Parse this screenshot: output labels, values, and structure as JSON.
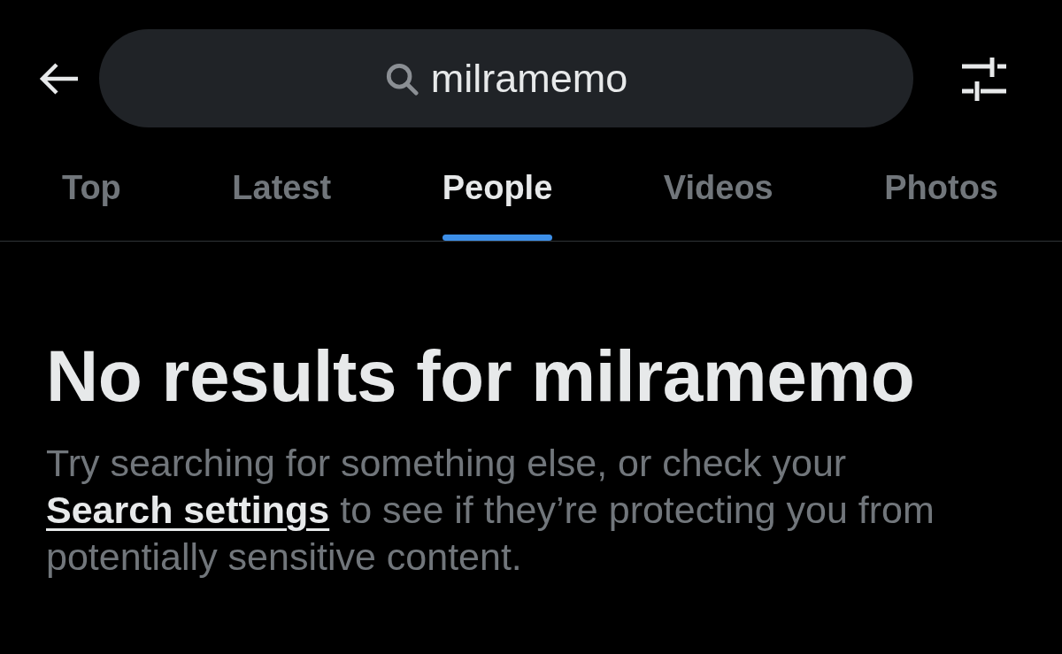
{
  "search": {
    "value": "milramemo"
  },
  "tabs": [
    {
      "label": "Top",
      "selected": false
    },
    {
      "label": "Latest",
      "selected": false
    },
    {
      "label": "People",
      "selected": true
    },
    {
      "label": "Videos",
      "selected": false
    },
    {
      "label": "Photos",
      "selected": false
    }
  ],
  "empty_state": {
    "title": "No results for milramemo",
    "text_before": "Try searching for something else, or check your ",
    "link": "Search settings",
    "text_after": " to see if they’re protecting you from potentially sensitive content."
  }
}
